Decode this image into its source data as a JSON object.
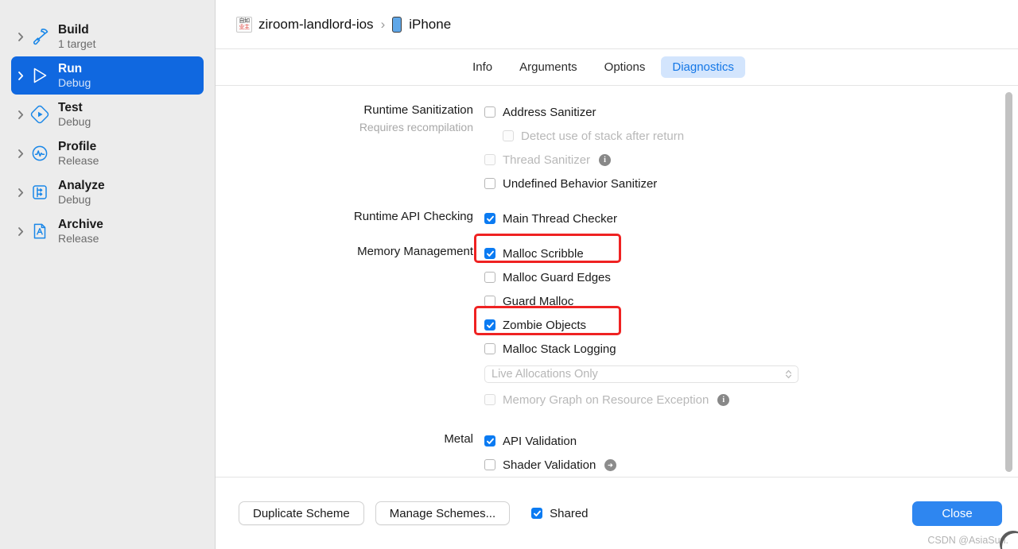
{
  "sidebar": {
    "items": [
      {
        "title": "Build",
        "subtitle": "1 target",
        "icon": "hammer-icon",
        "selected": false
      },
      {
        "title": "Run",
        "subtitle": "Debug",
        "icon": "play-icon",
        "selected": true
      },
      {
        "title": "Test",
        "subtitle": "Debug",
        "icon": "test-diamond-icon",
        "selected": false
      },
      {
        "title": "Profile",
        "subtitle": "Release",
        "icon": "waveform-icon",
        "selected": false
      },
      {
        "title": "Analyze",
        "subtitle": "Debug",
        "icon": "analyze-icon",
        "selected": false
      },
      {
        "title": "Archive",
        "subtitle": "Release",
        "icon": "archive-icon",
        "selected": false
      }
    ]
  },
  "breadcrumb": {
    "app_icon_top": "自如",
    "app_icon_bottom": "业主",
    "scheme": "ziroom-landlord-ios",
    "separator": "›",
    "destination": "iPhone"
  },
  "tabs": [
    {
      "label": "Info",
      "active": false
    },
    {
      "label": "Arguments",
      "active": false
    },
    {
      "label": "Options",
      "active": false
    },
    {
      "label": "Diagnostics",
      "active": true
    }
  ],
  "sections": {
    "runtime_sanitization": {
      "label": "Runtime Sanitization",
      "sublabel": "Requires recompilation",
      "rows": [
        {
          "label": "Address Sanitizer",
          "checked": false,
          "disabled": false,
          "indent": false,
          "accessory": "none"
        },
        {
          "label": "Detect use of stack after return",
          "checked": false,
          "disabled": true,
          "indent": true,
          "accessory": "none"
        },
        {
          "label": "Thread Sanitizer",
          "checked": false,
          "disabled": true,
          "indent": false,
          "accessory": "info"
        },
        {
          "label": "Undefined Behavior Sanitizer",
          "checked": false,
          "disabled": false,
          "indent": false,
          "accessory": "none"
        }
      ]
    },
    "runtime_api_checking": {
      "label": "Runtime API Checking",
      "rows": [
        {
          "label": "Main Thread Checker",
          "checked": true,
          "disabled": false,
          "indent": false,
          "accessory": "none"
        }
      ]
    },
    "memory_management": {
      "label": "Memory Management",
      "rows": [
        {
          "label": "Malloc Scribble",
          "checked": true,
          "disabled": false,
          "indent": false,
          "accessory": "none"
        },
        {
          "label": "Malloc Guard Edges",
          "checked": false,
          "disabled": false,
          "indent": false,
          "accessory": "none"
        },
        {
          "label": "Guard Malloc",
          "checked": false,
          "disabled": false,
          "indent": false,
          "accessory": "none"
        },
        {
          "label": "Zombie Objects",
          "checked": true,
          "disabled": false,
          "indent": false,
          "accessory": "none"
        },
        {
          "label": "Malloc Stack Logging",
          "checked": false,
          "disabled": false,
          "indent": false,
          "accessory": "none"
        }
      ],
      "select": {
        "value": "Live Allocations Only",
        "disabled": true
      },
      "extra_rows": [
        {
          "label": "Memory Graph on Resource Exception",
          "checked": false,
          "disabled": true,
          "indent": false,
          "accessory": "info"
        }
      ]
    },
    "metal": {
      "label": "Metal",
      "rows": [
        {
          "label": "API Validation",
          "checked": true,
          "disabled": false,
          "indent": false,
          "accessory": "none"
        },
        {
          "label": "Shader Validation",
          "checked": false,
          "disabled": false,
          "indent": false,
          "accessory": "arrow"
        }
      ]
    }
  },
  "annotations": [
    {
      "target": "Malloc Scribble",
      "color": "#ef2222"
    },
    {
      "target": "Zombie Objects",
      "color": "#ef2222"
    }
  ],
  "footer": {
    "duplicate_scheme": "Duplicate Scheme",
    "manage_schemes": "Manage Schemes...",
    "shared_label": "Shared",
    "shared_checked": true,
    "close": "Close"
  },
  "watermark": "CSDN @AsiaSun.",
  "colors": {
    "accent_blue": "#0b7bf2",
    "selection_blue": "#1068e0",
    "tab_active_bg": "#d3e5fd",
    "annotation_red": "#ef2222",
    "sidebar_bg": "#ececec"
  }
}
